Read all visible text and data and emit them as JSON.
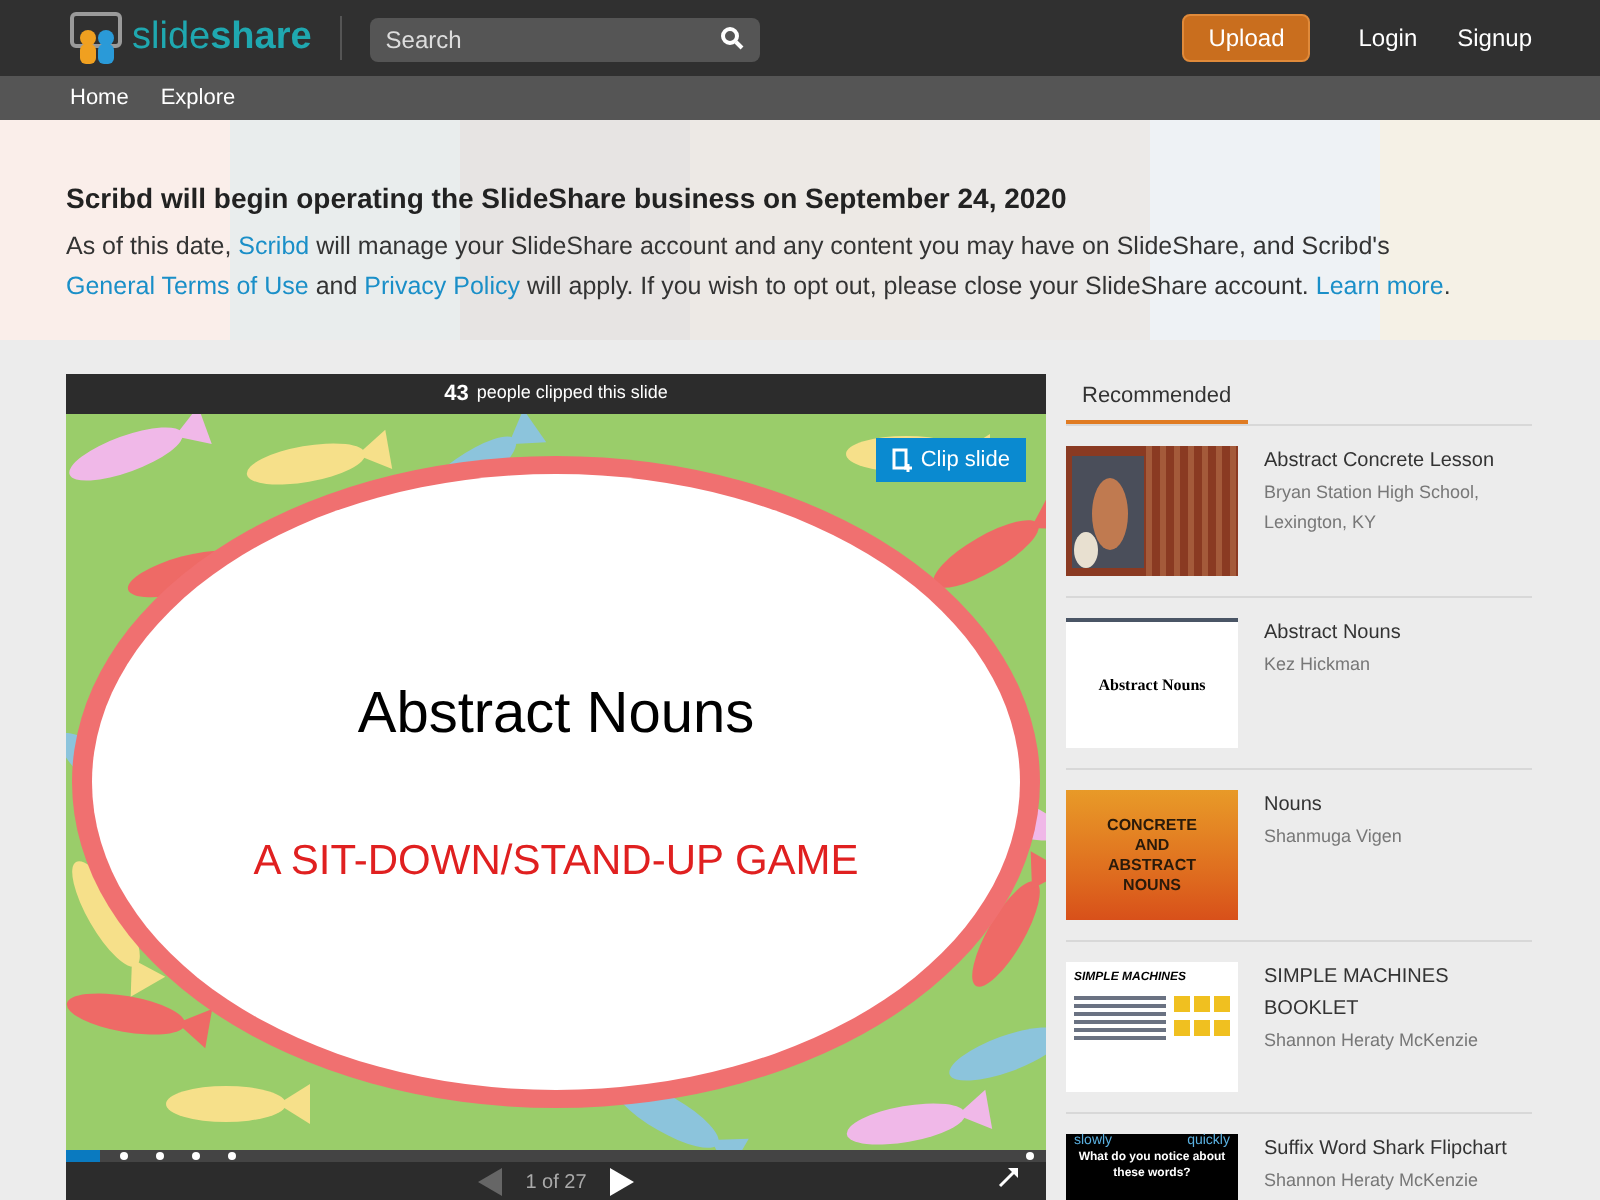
{
  "header": {
    "logo": {
      "text_light": "slide",
      "text_bold": "share"
    },
    "search": {
      "placeholder": "Search"
    },
    "upload": "Upload",
    "login": "Login",
    "signup": "Signup"
  },
  "nav": [
    {
      "label": "Home"
    },
    {
      "label": "Explore"
    }
  ],
  "banner": {
    "title": "Scribd will begin operating the SlideShare business on September 24, 2020",
    "text": [
      {
        "t": "As of this date, ",
        "link": false
      },
      {
        "t": "Scribd",
        "link": true
      },
      {
        "t": " will manage your SlideShare account and any content you may have on SlideShare, and Scribd's ",
        "link": false
      },
      {
        "t": "General Terms of Use",
        "link": true
      },
      {
        "t": " and ",
        "link": false
      },
      {
        "t": "Privacy Policy",
        "link": true
      },
      {
        "t": " will apply. If you wish to opt out, please close your SlideShare account. ",
        "link": false
      },
      {
        "t": "Learn more",
        "link": true
      },
      {
        "t": ".",
        "link": false
      }
    ]
  },
  "player": {
    "clips_count": "43",
    "clips_text": "people clipped this slide",
    "clip_button": "Clip slide",
    "slide": {
      "title": "Abstract Nouns",
      "subtitle": "A SIT-DOWN/STAND-UP GAME"
    },
    "progress": {
      "level": 0.035
    },
    "page": "1 of 27"
  },
  "sidebar": {
    "tabs": [
      {
        "label": "Recommended",
        "selected": true
      }
    ],
    "items": [
      {
        "title": "Abstract Concrete Lesson",
        "author": "Bryan Station High School, Lexington, KY"
      },
      {
        "title": "Abstract Nouns",
        "author": "Kez Hickman",
        "thumb": {
          "kind": "white",
          "lines": [
            "Abstract Nouns"
          ]
        }
      },
      {
        "title": "Nouns",
        "author": "Shanmuga Vigen",
        "thumb": {
          "kind": "orange",
          "lines": [
            "CONCRETE",
            "AND",
            "ABSTRACT",
            "NOUNS"
          ]
        }
      },
      {
        "title": "SIMPLE MACHINES BOOKLET",
        "author": "Shannon Heraty McKenzie",
        "thumb": {
          "kind": "doc",
          "lines": [
            "SIMPLE MACHINES"
          ]
        }
      },
      {
        "title": "Suffix Word Shark Flipchart",
        "author": "Shannon Heraty McKenzie",
        "thumb": {
          "kind": "black",
          "lines": [
            "slowly",
            "quickly",
            "What do you notice about these words?"
          ]
        }
      }
    ]
  }
}
